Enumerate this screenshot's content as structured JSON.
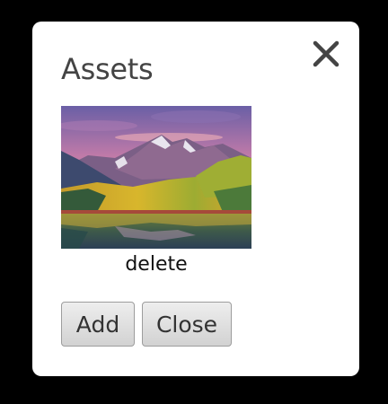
{
  "dialog": {
    "title": "Assets",
    "close_icon": "close-x-icon",
    "assets": [
      {
        "thumbnail": "mountain-lake-landscape",
        "action_label": "delete"
      }
    ],
    "buttons": {
      "add_label": "Add",
      "close_label": "Close"
    }
  }
}
